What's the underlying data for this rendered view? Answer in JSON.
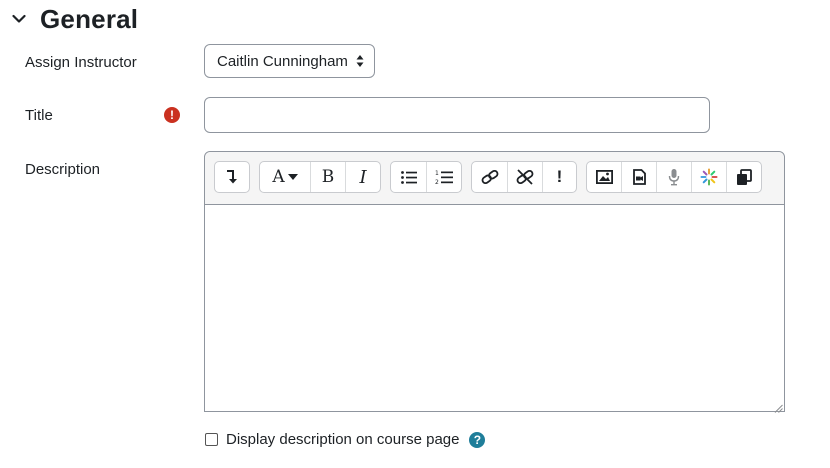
{
  "section": {
    "title": "General"
  },
  "fields": {
    "instructor": {
      "label": "Assign Instructor",
      "value": "Caitlin Cunningham"
    },
    "title": {
      "label": "Title",
      "value": "",
      "required_mark": "!"
    },
    "description": {
      "label": "Description"
    }
  },
  "toolbar": {
    "font_glyph": "A",
    "bold_glyph": "B",
    "italic_glyph": "I",
    "accessibility_glyph": "!",
    "icons": [
      "collapse-icon",
      "font-style-icon",
      "bold-icon",
      "italic-icon",
      "unordered-list-icon",
      "ordered-list-icon",
      "link-icon",
      "unlink-icon",
      "accessibility-checker-icon",
      "image-icon",
      "media-icon",
      "record-audio-icon",
      "h5p-icon",
      "manage-files-icon"
    ]
  },
  "display_option": {
    "label": "Display description on course page",
    "checked": false,
    "help_glyph": "?"
  },
  "colors": {
    "required": "#ca3120",
    "help": "#1f7e9a",
    "border": "#8f959e",
    "toolbar_bg": "#f5f5f5"
  }
}
